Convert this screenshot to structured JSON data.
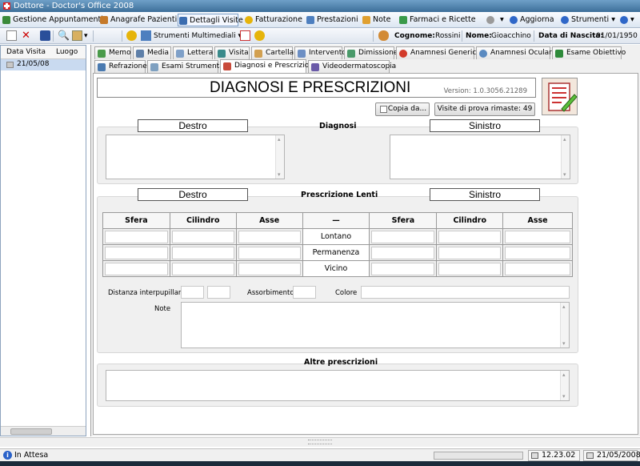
{
  "window": {
    "title": "Dottore - Doctor's Office 2008"
  },
  "menu": [
    {
      "label": "Gestione Appuntamenti",
      "color": "#3a8a3a"
    },
    {
      "label": "Anagrafe Pazienti",
      "color": "#c57a2a"
    },
    {
      "label": "Dettagli Visite",
      "color": "#3b6db0"
    },
    {
      "label": "Fatturazione",
      "color": "#e6b40a"
    },
    {
      "label": "Prestazioni",
      "color": "#4d7fbf"
    },
    {
      "label": "Note",
      "color": "#e0a030"
    },
    {
      "label": "Farmaci e Ricette",
      "color": "#3a9a4a"
    },
    {
      "label": "Aggiorna",
      "color": "#2f67c8"
    },
    {
      "label": "Strumenti",
      "color": "#2f67c8"
    }
  ],
  "toolbar": {
    "multimedia_label": "Strumenti Multimediali",
    "cognome_label": "Cognome:",
    "cognome_value": "Rossini",
    "nome_label": "Nome:",
    "nome_value": "Gioacchino",
    "nascita_label": "Data di Nascita:",
    "nascita_value": "01/01/1950"
  },
  "visits": {
    "col_date": "Data Visita",
    "col_place": "Luogo",
    "rows": [
      {
        "date": "21/05/08"
      }
    ]
  },
  "tabs_row1": [
    "Memo",
    "Media",
    "Lettera",
    "Visita",
    "Cartella",
    "Intervento",
    "Dimissione",
    "Anamnesi Generica",
    "Anamnesi Oculare",
    "Esame Obiettivo"
  ],
  "tabs_row2": [
    "Refrazione",
    "Esami Strumentali",
    "Diagnosi e Prescrizioni",
    "Videodermatoscopia"
  ],
  "page": {
    "title": "DIAGNOSI E PRESCRIZIONI",
    "version": "Version: 1.0.3056.21289",
    "copy_button": "Copia da...",
    "trial_label": "Visite di prova rimaste: 49"
  },
  "diagnosi": {
    "label": "Diagnosi",
    "left": "Destro",
    "right": "Sinistro"
  },
  "lenti": {
    "label": "Prescrizione Lenti",
    "left": "Destro",
    "right": "Sinistro",
    "headers": [
      "Sfera",
      "Cilindro",
      "Asse",
      "—",
      "Sfera",
      "Cilindro",
      "Asse"
    ],
    "rows": [
      "Lontano",
      "Permanenza",
      "Vicino"
    ]
  },
  "fields": {
    "distanza": "Distanza interpupillare",
    "assorbimento": "Assorbimento",
    "colore": "Colore",
    "note": "Note"
  },
  "altre": {
    "label": "Altre prescrizioni"
  },
  "status": {
    "text": "In Attesa",
    "time": "12.23.02",
    "date": "21/05/2008"
  }
}
